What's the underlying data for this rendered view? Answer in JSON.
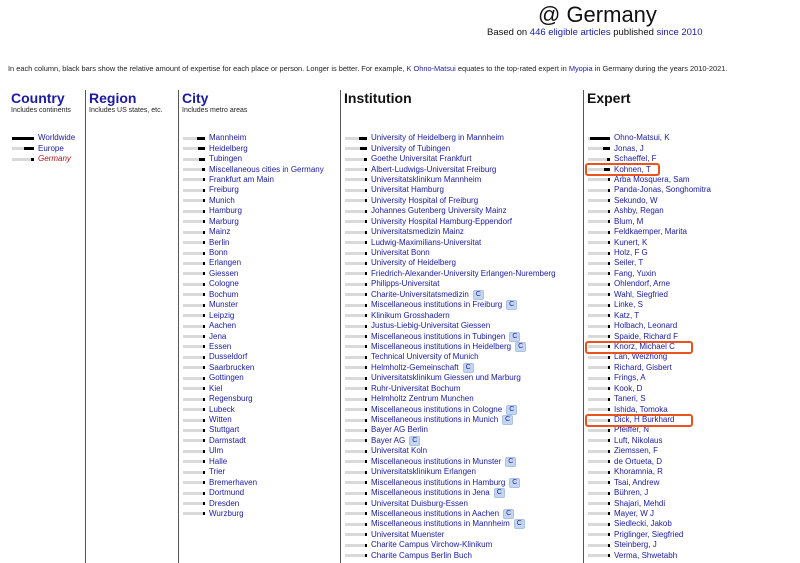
{
  "header": {
    "title": "@ Germany",
    "subtitle_prefix": "Based on",
    "subtitle_count": "446 eligible articles",
    "subtitle_mid": "published",
    "subtitle_since": "since 2010"
  },
  "description": {
    "part1": "In each column, black bars show the relative amount of expertise for each place or person. Longer is better. For example,",
    "example_expert": "K Ohno-Matsui",
    "part2": "equates to the top-rated expert in",
    "example_topic": "Myopia",
    "part3": "in Germany during the years 2010-2021."
  },
  "columns": {
    "country": {
      "title": "Country",
      "sub": "Includes continents",
      "items": [
        {
          "label": "Worldwide",
          "fill": 1.0
        },
        {
          "label": "Europe",
          "fill": 0.45
        },
        {
          "label": "Germany",
          "fill": 0.12
        }
      ]
    },
    "region": {
      "title": "Region",
      "sub": "Includes US states, etc."
    },
    "city": {
      "title": "City",
      "sub": "Includes metro areas",
      "items": [
        {
          "label": "Mannheim",
          "fill": 0.35
        },
        {
          "label": "Heidelberg",
          "fill": 0.32
        },
        {
          "label": "Tubingen",
          "fill": 0.25
        },
        {
          "label": "Miscellaneous cities in Germany",
          "fill": 0.15
        },
        {
          "label": "Frankfurt am Main",
          "fill": 0.1
        },
        {
          "label": "Freiburg",
          "fill": 0.1
        },
        {
          "label": "Munich",
          "fill": 0.08
        },
        {
          "label": "Hamburg",
          "fill": 0.08
        },
        {
          "label": "Marburg",
          "fill": 0.07
        },
        {
          "label": "Mainz",
          "fill": 0.07
        },
        {
          "label": "Berlin",
          "fill": 0.06
        },
        {
          "label": "Bonn",
          "fill": 0.06
        },
        {
          "label": "Erlangen",
          "fill": 0.05
        },
        {
          "label": "Giessen",
          "fill": 0.05
        },
        {
          "label": "Cologne",
          "fill": 0.05
        },
        {
          "label": "Bochum",
          "fill": 0.05
        },
        {
          "label": "Munster",
          "fill": 0.04
        },
        {
          "label": "Leipzig",
          "fill": 0.04
        },
        {
          "label": "Aachen",
          "fill": 0.04
        },
        {
          "label": "Jena",
          "fill": 0.04
        },
        {
          "label": "Essen",
          "fill": 0.04
        },
        {
          "label": "Dusseldorf",
          "fill": 0.03
        },
        {
          "label": "Saarbrucken",
          "fill": 0.03
        },
        {
          "label": "Gottingen",
          "fill": 0.03
        },
        {
          "label": "Kiel",
          "fill": 0.03
        },
        {
          "label": "Regensburg",
          "fill": 0.03
        },
        {
          "label": "Lubeck",
          "fill": 0.03
        },
        {
          "label": "Witten",
          "fill": 0.03
        },
        {
          "label": "Stuttgart",
          "fill": 0.03
        },
        {
          "label": "Darmstadt",
          "fill": 0.02
        },
        {
          "label": "Ulm",
          "fill": 0.02
        },
        {
          "label": "Halle",
          "fill": 0.02
        },
        {
          "label": "Trier",
          "fill": 0.02
        },
        {
          "label": "Bremerhaven",
          "fill": 0.02
        },
        {
          "label": "Dortmund",
          "fill": 0.02
        },
        {
          "label": "Dresden",
          "fill": 0.02
        },
        {
          "label": "Wurzburg",
          "fill": 0.02
        }
      ]
    },
    "institution": {
      "title": "Institution",
      "items": [
        {
          "label": "University of Heidelberg in Mannheim",
          "fill": 0.35,
          "badge": ""
        },
        {
          "label": "University of Tubingen",
          "fill": 0.3,
          "badge": ""
        },
        {
          "label": "Goethe Universitat Frankfurt",
          "fill": 0.12,
          "badge": ""
        },
        {
          "label": "Albert-Ludwigs-Universitat Freiburg",
          "fill": 0.1,
          "badge": ""
        },
        {
          "label": "Universitatsklinikum Mannheim",
          "fill": 0.1,
          "badge": ""
        },
        {
          "label": "Universitat Hamburg",
          "fill": 0.09,
          "badge": ""
        },
        {
          "label": "University Hospital of Freiburg",
          "fill": 0.08,
          "badge": ""
        },
        {
          "label": "Johannes Gutenberg University Mainz",
          "fill": 0.08,
          "badge": ""
        },
        {
          "label": "University Hospital Hamburg-Eppendorf",
          "fill": 0.08,
          "badge": ""
        },
        {
          "label": "Universitatsmedizin Mainz",
          "fill": 0.07,
          "badge": ""
        },
        {
          "label": "Ludwig-Maximilians-Universitat",
          "fill": 0.07,
          "badge": ""
        },
        {
          "label": "Universitat Bonn",
          "fill": 0.06,
          "badge": ""
        },
        {
          "label": "University of Heidelberg",
          "fill": 0.06,
          "badge": ""
        },
        {
          "label": "Friedrich-Alexander-University Erlangen-Nuremberg",
          "fill": 0.05,
          "badge": ""
        },
        {
          "label": "Philipps-Universitat",
          "fill": 0.05,
          "badge": ""
        },
        {
          "label": "Charite-Universitatsmedizin",
          "fill": 0.05,
          "badge": "C"
        },
        {
          "label": "Miscellaneous institutions in Freiburg",
          "fill": 0.05,
          "badge": "C"
        },
        {
          "label": "Klinikum Grosshadern",
          "fill": 0.04,
          "badge": ""
        },
        {
          "label": "Justus-Liebig-Universitat Giessen",
          "fill": 0.04,
          "badge": ""
        },
        {
          "label": "Miscellaneous institutions in Tubingen",
          "fill": 0.04,
          "badge": "C"
        },
        {
          "label": "Miscellaneous institutions in Heidelberg",
          "fill": 0.04,
          "badge": "C"
        },
        {
          "label": "Technical University of Munich",
          "fill": 0.04,
          "badge": ""
        },
        {
          "label": "Helmholtz-Gemeinschaft",
          "fill": 0.03,
          "badge": "C"
        },
        {
          "label": "Universitatsklinikum Giessen und Marburg",
          "fill": 0.03,
          "badge": ""
        },
        {
          "label": "Ruhr-Universitat Bochum",
          "fill": 0.03,
          "badge": ""
        },
        {
          "label": "Helmholtz Zentrum Munchen",
          "fill": 0.03,
          "badge": ""
        },
        {
          "label": "Miscellaneous institutions in Cologne",
          "fill": 0.03,
          "badge": "C"
        },
        {
          "label": "Miscellaneous institutions in Munich",
          "fill": 0.03,
          "badge": "C"
        },
        {
          "label": "Bayer AG Berlin",
          "fill": 0.03,
          "badge": ""
        },
        {
          "label": "Bayer AG",
          "fill": 0.02,
          "badge": "C"
        },
        {
          "label": "Universitat Koln",
          "fill": 0.02,
          "badge": ""
        },
        {
          "label": "Miscellaneous institutions in Munster",
          "fill": 0.02,
          "badge": "C"
        },
        {
          "label": "Universitatsklinikum Erlangen",
          "fill": 0.02,
          "badge": ""
        },
        {
          "label": "Miscellaneous institutions in Hamburg",
          "fill": 0.02,
          "badge": "C"
        },
        {
          "label": "Miscellaneous institutions in Jena",
          "fill": 0.02,
          "badge": "C"
        },
        {
          "label": "Universitat Duisburg-Essen",
          "fill": 0.02,
          "badge": ""
        },
        {
          "label": "Miscellaneous institutions in Aachen",
          "fill": 0.02,
          "badge": "C"
        },
        {
          "label": "Miscellaneous institutions in Mannheim",
          "fill": 0.02,
          "badge": "C"
        },
        {
          "label": "Universitat Muenster",
          "fill": 0.02,
          "badge": ""
        },
        {
          "label": "Charite Campus Virchow-Klinikum",
          "fill": 0.02,
          "badge": ""
        },
        {
          "label": "Charite Campus Berlin Buch",
          "fill": 0.02,
          "badge": ""
        }
      ]
    },
    "expert": {
      "title": "Expert",
      "items": [
        {
          "label": "Ohno-Matsui, K",
          "fill": 0.9
        },
        {
          "label": "Jonas, J",
          "fill": 0.3
        },
        {
          "label": "Schaeffel, F",
          "fill": 0.12
        },
        {
          "label": "Kohnen, T",
          "fill": 0.25
        },
        {
          "label": "Arba Mosquera, Sam",
          "fill": 0.06
        },
        {
          "label": "Panda-Jonas, Songhomitra",
          "fill": 0.06
        },
        {
          "label": "Sekundo, W",
          "fill": 0.06
        },
        {
          "label": "Ashby, Regan",
          "fill": 0.05
        },
        {
          "label": "Blum, M",
          "fill": 0.05
        },
        {
          "label": "Feldkaemper, Marita",
          "fill": 0.05
        },
        {
          "label": "Kunert, K",
          "fill": 0.05
        },
        {
          "label": "Holz, F G",
          "fill": 0.04
        },
        {
          "label": "Seiler, T",
          "fill": 0.04
        },
        {
          "label": "Fang, Yuxin",
          "fill": 0.04
        },
        {
          "label": "Ohlendorf, Arne",
          "fill": 0.04
        },
        {
          "label": "Wahl, Siegfried",
          "fill": 0.04
        },
        {
          "label": "Linke, S",
          "fill": 0.04
        },
        {
          "label": "Katz, T",
          "fill": 0.03
        },
        {
          "label": "Holbach, Leonard",
          "fill": 0.03
        },
        {
          "label": "Spaide, Richard F",
          "fill": 0.03
        },
        {
          "label": "Knorz, Michael C",
          "fill": 0.03
        },
        {
          "label": "Lan, Weizhong",
          "fill": 0.03
        },
        {
          "label": "Richard, Gisbert",
          "fill": 0.03
        },
        {
          "label": "Frings, A",
          "fill": 0.03
        },
        {
          "label": "Kook, D",
          "fill": 0.03
        },
        {
          "label": "Taneri, S",
          "fill": 0.03
        },
        {
          "label": "Ishida, Tomoka",
          "fill": 0.02
        },
        {
          "label": "Dick, H Burkhard",
          "fill": 0.02
        },
        {
          "label": "Pfeiffer, N",
          "fill": 0.02
        },
        {
          "label": "Luft, Nikolaus",
          "fill": 0.02
        },
        {
          "label": "Ziemssen, F",
          "fill": 0.02
        },
        {
          "label": "de Ortueta, D",
          "fill": 0.02
        },
        {
          "label": "Khoramnia, R",
          "fill": 0.02
        },
        {
          "label": "Tsai, Andrew",
          "fill": 0.02
        },
        {
          "label": "Bühren, J",
          "fill": 0.02
        },
        {
          "label": "Shajari, Mehdi",
          "fill": 0.02
        },
        {
          "label": "Mayer, W J",
          "fill": 0.02
        },
        {
          "label": "Siedlecki, Jakob",
          "fill": 0.02
        },
        {
          "label": "Priglinger, Siegfried",
          "fill": 0.02
        },
        {
          "label": "Steinberg, J",
          "fill": 0.02
        },
        {
          "label": "Verma, Shwetabh",
          "fill": 0.02
        }
      ],
      "highlighted": [
        "Kohnen, T",
        "Knorz, Michael C",
        "Dick, H Burkhard"
      ]
    }
  },
  "colors": {
    "link": "#1a1aa6",
    "highlight_box": "#e8531f",
    "current_country": "#b3131b",
    "bar_bg": "#d9d9d9",
    "bar_fill": "#000000",
    "badge_bg": "#c5d7f0"
  }
}
